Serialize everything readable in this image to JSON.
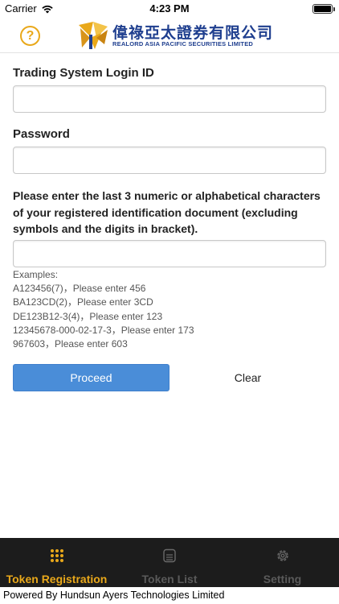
{
  "status_bar": {
    "carrier": "Carrier",
    "time": "4:23 PM",
    "battery_level": 1.0
  },
  "header": {
    "help_icon": "question-circle-icon",
    "help_glyph": "?",
    "logo_cn": "偉祿亞太證券有限公司",
    "logo_en": "REALORD ASIA PACIFIC SECURITIES LIMITED"
  },
  "form": {
    "login_id_label": "Trading System Login ID",
    "login_id_value": "",
    "password_label": "Password",
    "password_value": "",
    "instruction": "Please enter the last 3 numeric or alphabetical characters of your registered identification document (excluding symbols and the digits in bracket).",
    "id_chars_value": "",
    "examples_title": "Examples:",
    "examples": [
      "A123456(7)，Please enter 456",
      "BA123CD(2)，Please enter 3CD",
      "DE123B12-3(4)，Please enter 123",
      "12345678-000-02-17-3，Please enter 173",
      "967603，Please enter 603"
    ],
    "proceed_label": "Proceed",
    "clear_label": "Clear"
  },
  "tabbar": {
    "tabs": [
      {
        "label": "Token Registration",
        "icon": "grid-dots-icon",
        "active": true
      },
      {
        "label": "Token List",
        "icon": "list-box-icon",
        "active": false
      },
      {
        "label": "Setting",
        "icon": "gear-icon",
        "active": false
      }
    ]
  },
  "footer": {
    "text": "Powered By Hundsun Ayers Technologies Limited"
  },
  "colors": {
    "accent": "#e9a81a",
    "primary_button": "#4a8dd8",
    "tabbar_bg": "#1c1c1c",
    "logo_blue": "#1f3f8f"
  }
}
